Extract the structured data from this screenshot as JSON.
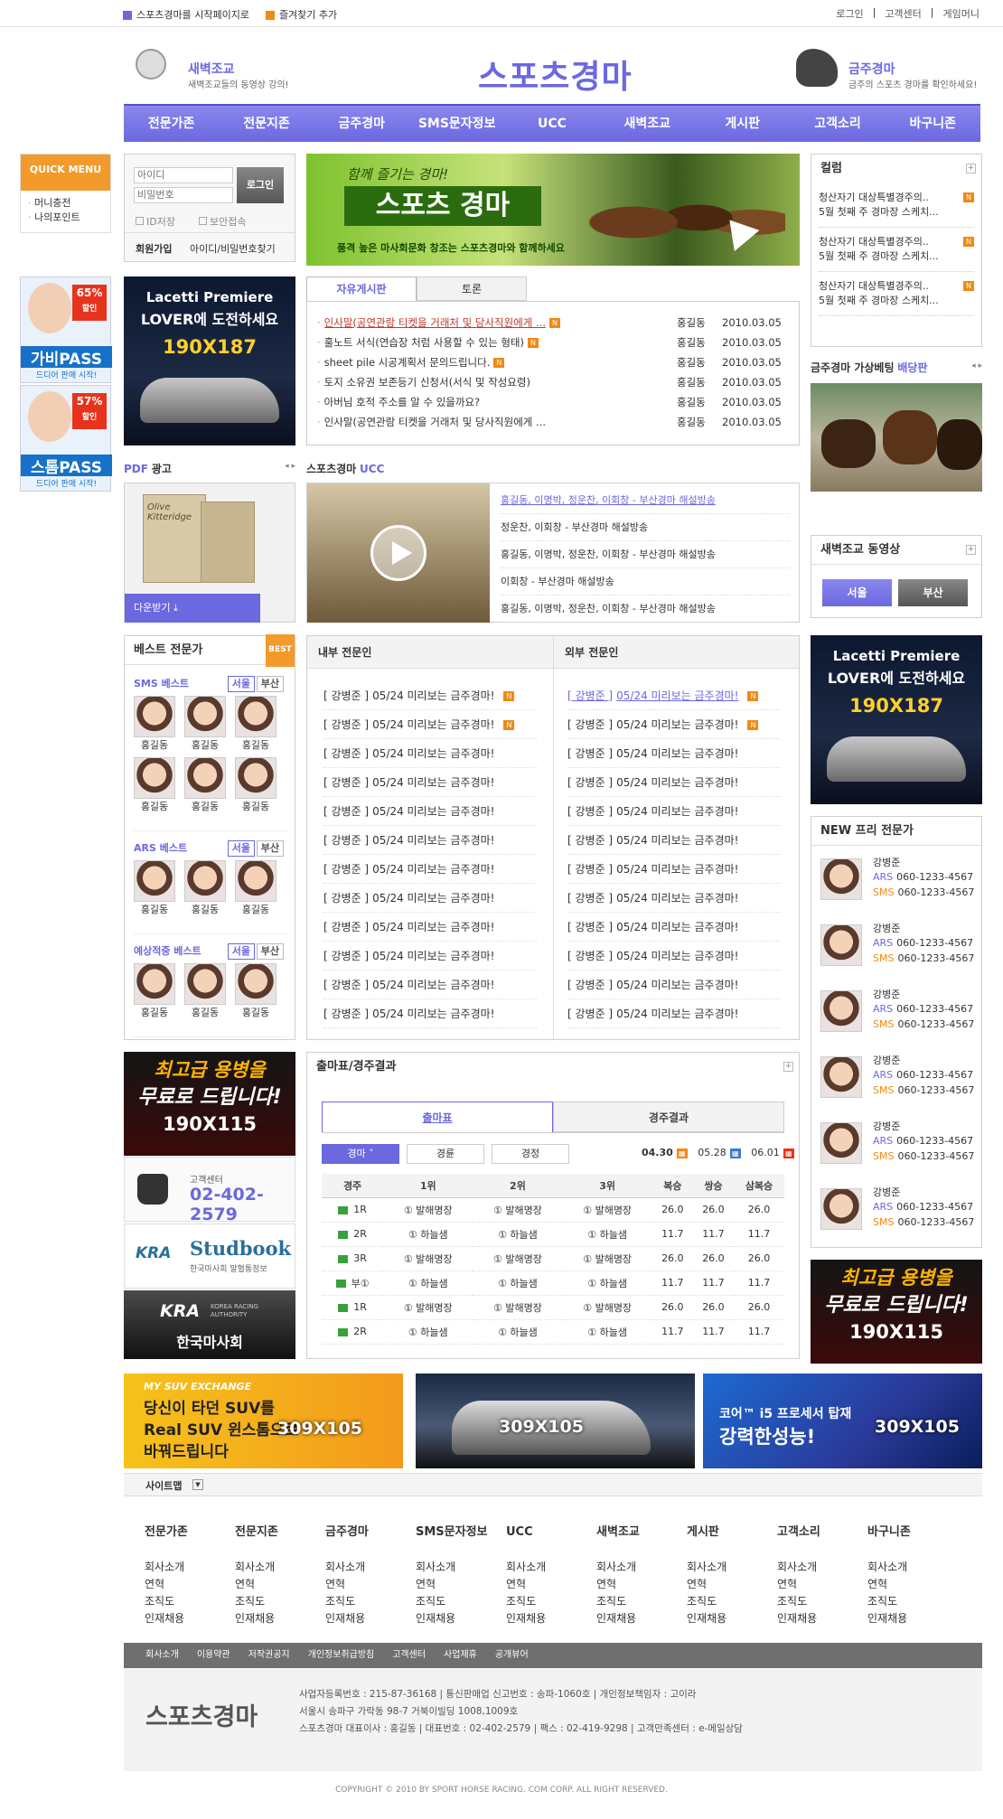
{
  "util": {
    "left": [
      "스포츠경마를 시작페이지로",
      "즐겨찾기 추가"
    ],
    "right": [
      "로그인",
      "고객센터",
      "게임머니"
    ]
  },
  "header": {
    "logo": "스포츠경마",
    "left_title": "새벽조교",
    "left_desc": "새벽조교들의 동영상 강의!",
    "right_title": "금주경마",
    "right_desc": "금주의 스포츠 경마를 확인하세요!"
  },
  "gnb": [
    "전문가존",
    "전문지존",
    "금주경마",
    "SMS문자정보",
    "UCC",
    "새벽조교",
    "게시판",
    "고객소리",
    "바구니존"
  ],
  "quick": {
    "title": "QUICK MENU",
    "items": [
      "머니충전",
      "나의포인트"
    ]
  },
  "side_ads": [
    {
      "pct": "65%",
      "sub": "할인",
      "name": "가비PASS",
      "tag": "드디어 판매 시작!"
    },
    {
      "pct": "57%",
      "sub": "할인",
      "name": "스톰PASS",
      "tag": "드디어 판매 시작!"
    }
  ],
  "login": {
    "id_ph": "아이디",
    "pw_ph": "비밀번호",
    "btn": "로그인",
    "save": "ID저장",
    "secure": "보안접속",
    "join": "회원가입",
    "find": "아이디/비밀번호찾기"
  },
  "visual": {
    "script": "함께 즐기는 경마!",
    "title": "스포츠 경마",
    "desc": "품격 높은 마사회문화 창조는 스포츠경마와 함께하세요"
  },
  "board": {
    "tabs": [
      "자유게시판",
      "토론"
    ],
    "rows": [
      {
        "t": "인사말(공연관람 티켓을 거래처 및 당사직원에게 ...",
        "a": "홍길동",
        "d": "2010.03.05",
        "new": true
      },
      {
        "t": "훌노트 서식(연습장 처럼 사용할 수 있는 형태)",
        "a": "홍길동",
        "d": "2010.03.05",
        "new": true
      },
      {
        "t": "sheet pile 시공계획서 문의드립니다.",
        "a": "홍길동",
        "d": "2010.03.05",
        "new": true
      },
      {
        "t": "토지 소유권 보존등기 신청서(서식 및 작성요령)",
        "a": "홍길동",
        "d": "2010.03.05",
        "new": false
      },
      {
        "t": "아버님 호적 주소를 알 수 있을까요?",
        "a": "홍길동",
        "d": "2010.03.05",
        "new": false
      },
      {
        "t": "인사말(공연관람 티켓을 거래처 및 당사직원에게 ...",
        "a": "홍길동",
        "d": "2010.03.05",
        "new": false
      }
    ]
  },
  "ad_lacetti": {
    "line1": "Lacetti Premiere",
    "line2": "LOVER에 도전하세요",
    "size": "190X187"
  },
  "column": {
    "title": "컬럼",
    "items": [
      {
        "t": "청산자기 대상특별경주의..",
        "s": "5월 첫째 주 경마장 스케치..."
      },
      {
        "t": "청산자기 대상특별경주의..",
        "s": "5월 첫째 주 경마장 스케치..."
      },
      {
        "t": "청산자기 대상특별경주의..",
        "s": "5월 첫째 주 경마장 스케치..."
      }
    ]
  },
  "betting": {
    "title": "금주경마 가상베팅",
    "accent": "배당판"
  },
  "dawn": {
    "title": "새벽조교 동영상",
    "btn1": "서울",
    "btn2": "부산"
  },
  "pdf": {
    "title": "PDF",
    "title2": "광고",
    "book": "Olive Kitteridge",
    "download": "다운받기"
  },
  "ucc": {
    "title": "스포츠경마",
    "accent": "UCC",
    "items": [
      "홍길동, 이명박, 정운찬, 이회창 - 부산경마 해설방송",
      "정운찬, 이회창 - 부산경마 해설방송",
      "홍길동, 이명박, 정운찬, 이회창 - 부산경마 해설방송",
      "이회창 - 부산경마 해설방송",
      "홍길동, 이명박, 정운찬, 이회창 - 부산경마 해설방송"
    ]
  },
  "best": {
    "title": "베스트 전문가",
    "badge": "BEST",
    "groups": [
      {
        "label": "SMS 베스트",
        "rows": 2
      },
      {
        "label": "ARS 베스트",
        "rows": 1
      },
      {
        "label": "예상적중 베스트",
        "rows": 1
      }
    ],
    "tab1": "서울",
    "tab2": "부산",
    "name": "홍길동"
  },
  "experts": {
    "inner": "내부 전문인",
    "outer": "외부 전문인",
    "row": {
      "pre": "[ 강병준 ]",
      "title": "05/24 미리보는 금주경마!"
    }
  },
  "free": {
    "title": "NEW 프리 전문가",
    "name": "강병준",
    "ars": "ARS",
    "sms": "SMS",
    "phone": "060-1233-4567"
  },
  "cs": {
    "label": "고객센터",
    "phone": "02-402-2579"
  },
  "logos": {
    "studbook": "Studbook",
    "studbook_sub": "한국마사회 말혈통정보",
    "kra": "KRA",
    "kra_sub": "KOREA RACING AUTHORITY",
    "kra_name": "한국마사회"
  },
  "ad_free": {
    "line1": "최고급 용병을",
    "line2": "무료로 드립니다!",
    "size": "190X115"
  },
  "race": {
    "title": "출마표/경주결과",
    "tabs": [
      "출마표",
      "경주결과"
    ],
    "filters": [
      "경마",
      "경륜",
      "경정"
    ],
    "dates": [
      "04.30",
      "05.28",
      "06.01"
    ],
    "cols": [
      "경주",
      "1위",
      "2위",
      "3위",
      "복승",
      "쌍승",
      "삼복승"
    ],
    "rows": [
      [
        "1R",
        "① 발해명장",
        "① 발해명장",
        "① 발해명장",
        "26.0",
        "26.0",
        "26.0"
      ],
      [
        "2R",
        "① 하늘샘",
        "① 하늘샘",
        "① 하늘샘",
        "11.7",
        "11.7",
        "11.7"
      ],
      [
        "3R",
        "① 발해명장",
        "① 발해명장",
        "① 발해명장",
        "26.0",
        "26.0",
        "26.0"
      ],
      [
        "부①",
        "① 하늘샘",
        "① 하늘샘",
        "① 하늘샘",
        "11.7",
        "11.7",
        "11.7"
      ],
      [
        "1R",
        "① 발해명장",
        "① 발해명장",
        "① 발해명장",
        "26.0",
        "26.0",
        "26.0"
      ],
      [
        "2R",
        "① 하늘샘",
        "① 하늘샘",
        "① 하늘샘",
        "11.7",
        "11.7",
        "11.7"
      ]
    ]
  },
  "bottom_ads": [
    {
      "head": "MY SUV EXCHANGE",
      "l1": "당신이 타던 SUV를",
      "l2": "Real SUV 윈스톰으로",
      "l3": "바꿔드립니다",
      "size": "309X105"
    },
    {
      "size": "309X105"
    },
    {
      "l1": "코어™ i5 프로세서 탑재",
      "l2": "강력한성능!",
      "size": "309X105"
    }
  ],
  "sitemap": {
    "label": "사이트맵",
    "cols": [
      "전문가존",
      "전문지존",
      "금주경마",
      "SMS문자정보",
      "UCC",
      "새벽조교",
      "게시판",
      "고객소리",
      "바구니존"
    ],
    "items": [
      "회사소개",
      "연혁",
      "조직도",
      "인재채용"
    ]
  },
  "footer_nav": [
    "회사소개",
    "이용약관",
    "저작권공지",
    "개인정보취급방침",
    "고객센터",
    "사업제휴",
    "공개뷰어"
  ],
  "footer": {
    "logo": "스포츠경마",
    "l1": "사업자등록번호 : 215-87-36168  |  통신판매업 신고번호 : 송파-1060호  |  개인정보책임자 : 고이라",
    "l2": "서울시 송파구 가락동 98-7 거북이빌딩 1008,1009호",
    "l3": "스포츠경마 대표이사 : 홍길동  |  대표번호 : 02-402-2579  |  팩스 : 02-419-9298  |  고객만족센터 : e-메일상담",
    "copy": "COPYRIGHT © 2010 BY SPORT HORSE RACING. COM CORP. ALL RIGHT RESERVED."
  },
  "colors": {
    "accent": "#6b68e0",
    "orange": "#f08a14"
  }
}
